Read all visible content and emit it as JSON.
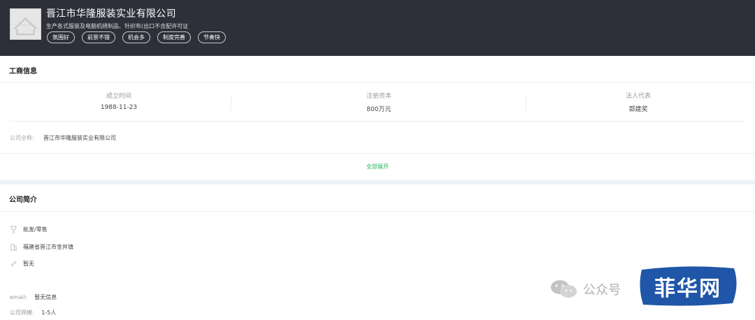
{
  "header": {
    "company_name": "晋江市华隆服装实业有限公司",
    "scope": "生产各式服装及电脑机绣制品、针织布(出口不含配许可证",
    "tags": [
      "氛围好",
      "前景不错",
      "机会多",
      "制度完善",
      "节奏快"
    ]
  },
  "business_info": {
    "title": "工商信息",
    "founded_label": "成立时间",
    "founded_value": "1988-11-23",
    "capital_label": "注册资本",
    "capital_value": "800万元",
    "rep_label": "法人代表",
    "rep_value": "郭建奖",
    "fullname_label": "公司全称:",
    "fullname_value": "晋江市华隆服装实业有限公司",
    "expand_label": "全部展开"
  },
  "intro": {
    "title": "公司简介",
    "industry": "批发/零售",
    "address": "福建省晋江市金井镇",
    "website": "暂无",
    "email_label": "email:",
    "email_value": "暂无信息",
    "size_label": "公司规模:",
    "size_value": "1-5人"
  },
  "watermark": {
    "text": "公众号",
    "badge": "菲华网"
  },
  "colors": {
    "header_bg": "#2e3039",
    "accent_green": "#27b15a",
    "badge_blue": "#1f56a8"
  }
}
